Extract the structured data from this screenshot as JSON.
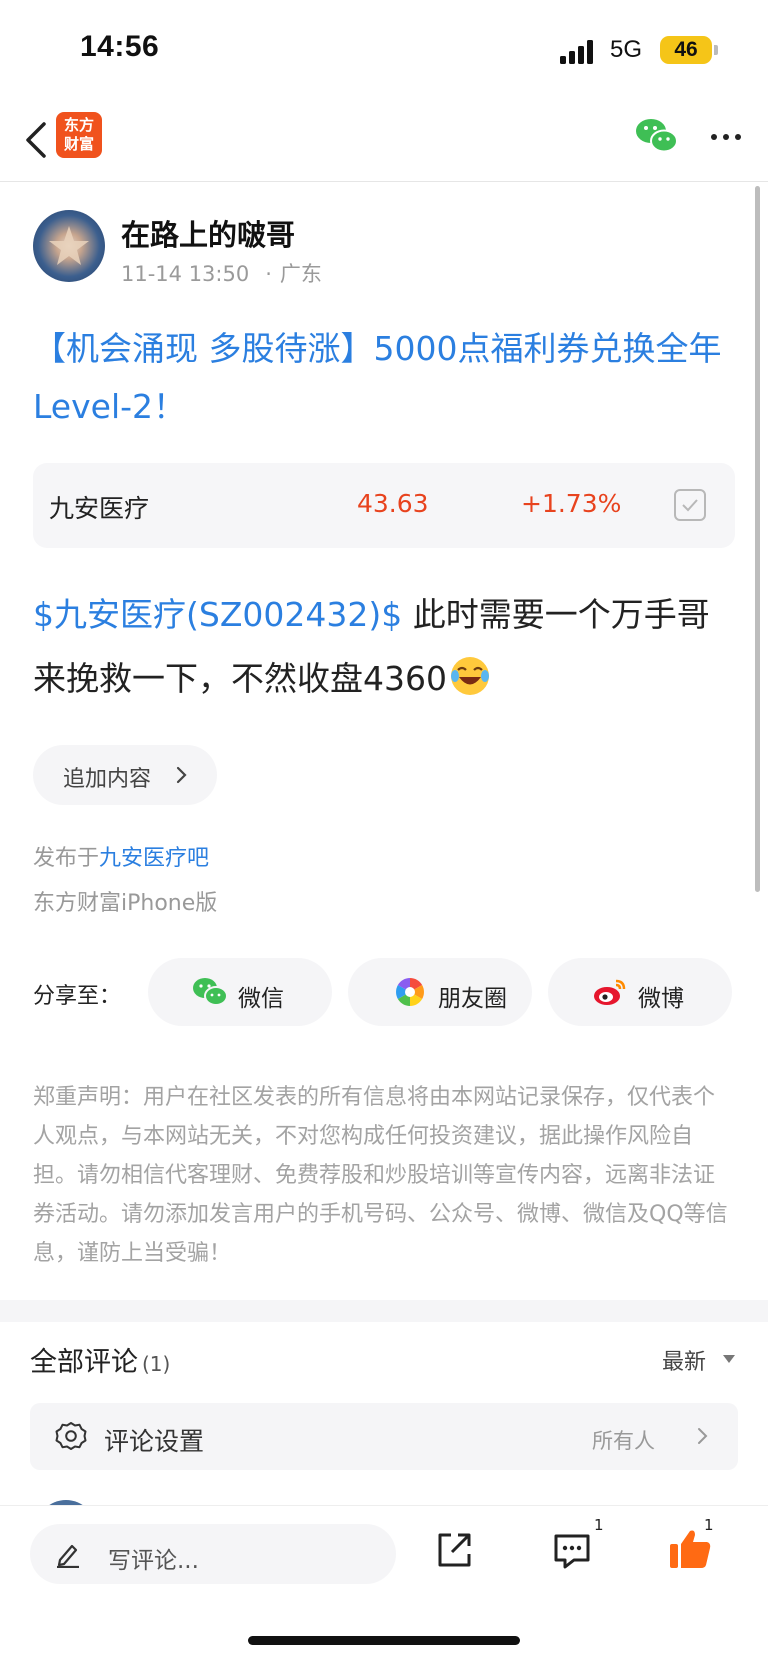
{
  "status_bar": {
    "time": "14:56",
    "network": "5G",
    "battery": "46"
  },
  "nav": {
    "logo_line1": "东方",
    "logo_line2": "财富"
  },
  "author": {
    "name": "在路上的啵哥",
    "date": "11-14 13:50",
    "separator": "·",
    "location": "广东"
  },
  "post": {
    "title": "【机会涌现 多股待涨】5000点福利券兑换全年Level-2！",
    "stock_tag": "$九安医疗(SZ002432)$",
    "body": "  此时需要一个万手哥来挽救一下，不然收盘4360"
  },
  "stock_card": {
    "name": "九安医疗",
    "price": "43.63",
    "change": "+1.73%"
  },
  "add_content": {
    "label": "追加内容"
  },
  "published": {
    "prefix": "发布于",
    "bar_name": "九安医疗吧",
    "client": "东方财富iPhone版"
  },
  "share": {
    "label": "分享至：",
    "wechat": "微信",
    "moments": "朋友圈",
    "weibo": "微博"
  },
  "disclaimer": "郑重声明：用户在社区发表的所有信息将由本网站记录保存，仅代表个人观点，与本网站无关，不对您构成任何投资建议，据此操作风险自担。请勿相信代客理财、免费荐股和炒股培训等宣传内容，远离非法证券活动。请勿添加发言用户的手机号码、公众号、微博、微信及QQ等信息，谨防上当受骗！",
  "comments": {
    "title": "全部评论",
    "count": "(1)",
    "sort": "最新",
    "settings_label": "评论设置",
    "settings_value": "所有人"
  },
  "bottom_bar": {
    "placeholder": "写评论...",
    "comment_count": "1",
    "like_count": "1"
  },
  "colors": {
    "accent_blue": "#2b7fe0",
    "up_red": "#e8431e",
    "brand_orange": "#f0521d",
    "like_orange": "#ff6a13",
    "wechat_green": "#3fbf55"
  },
  "icons": [
    "back-icon",
    "wechat-icon",
    "more-icon",
    "checkbox-icon",
    "laughing-emoji-icon",
    "chevron-right-icon",
    "moments-icon",
    "weibo-icon",
    "caret-down-icon",
    "gear-icon",
    "pencil-icon",
    "share-out-icon",
    "message-icon",
    "thumbs-up-icon"
  ]
}
